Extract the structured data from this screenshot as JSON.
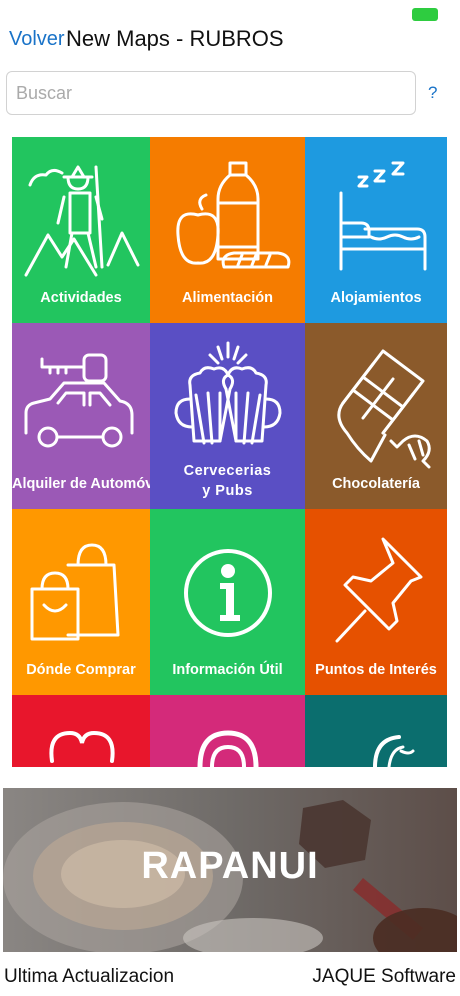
{
  "nav": {
    "back_label": "Volver",
    "title": "New Maps - RUBROS"
  },
  "search": {
    "placeholder": "Buscar",
    "value": "",
    "help_label": "?"
  },
  "categories": [
    {
      "label": "Actividades",
      "color": "#22c55f",
      "icon": "hiker-icon"
    },
    {
      "label": "Alimentación",
      "color": "#f57c00",
      "icon": "food-icon"
    },
    {
      "label": "Alojamientos",
      "color": "#1e9ae0",
      "icon": "bed-icon"
    },
    {
      "label": "Alquiler de Automóvil",
      "color": "#9b59b6",
      "icon": "car-key-icon"
    },
    {
      "label": "Cervecerias y Pubs",
      "label_line1": "Cervecerias",
      "label_line2": "y Pubs",
      "color": "#5a4fc4",
      "icon": "beer-mugs-icon"
    },
    {
      "label": "Chocolatería",
      "color": "#8b5a2b",
      "icon": "chocolate-icon"
    },
    {
      "label": "Dónde Comprar",
      "color": "#ff9800",
      "icon": "shopping-bags-icon"
    },
    {
      "label": "Información Útil",
      "color": "#22c55f",
      "icon": "info-icon"
    },
    {
      "label": "Puntos de Interés",
      "color": "#e65100",
      "icon": "pushpin-icon"
    },
    {
      "label": "",
      "color": "#e8162c",
      "icon": "heart-icon"
    },
    {
      "label": "",
      "color": "#d42a7a",
      "icon": "circle-icon"
    },
    {
      "label": "",
      "color": "#0b6e6e",
      "icon": "moon-icon"
    }
  ],
  "banner": {
    "title": "RAPANUI"
  },
  "footer": {
    "left_label": "Ultima Actualizacion",
    "right_label": "JAQUE Software"
  }
}
